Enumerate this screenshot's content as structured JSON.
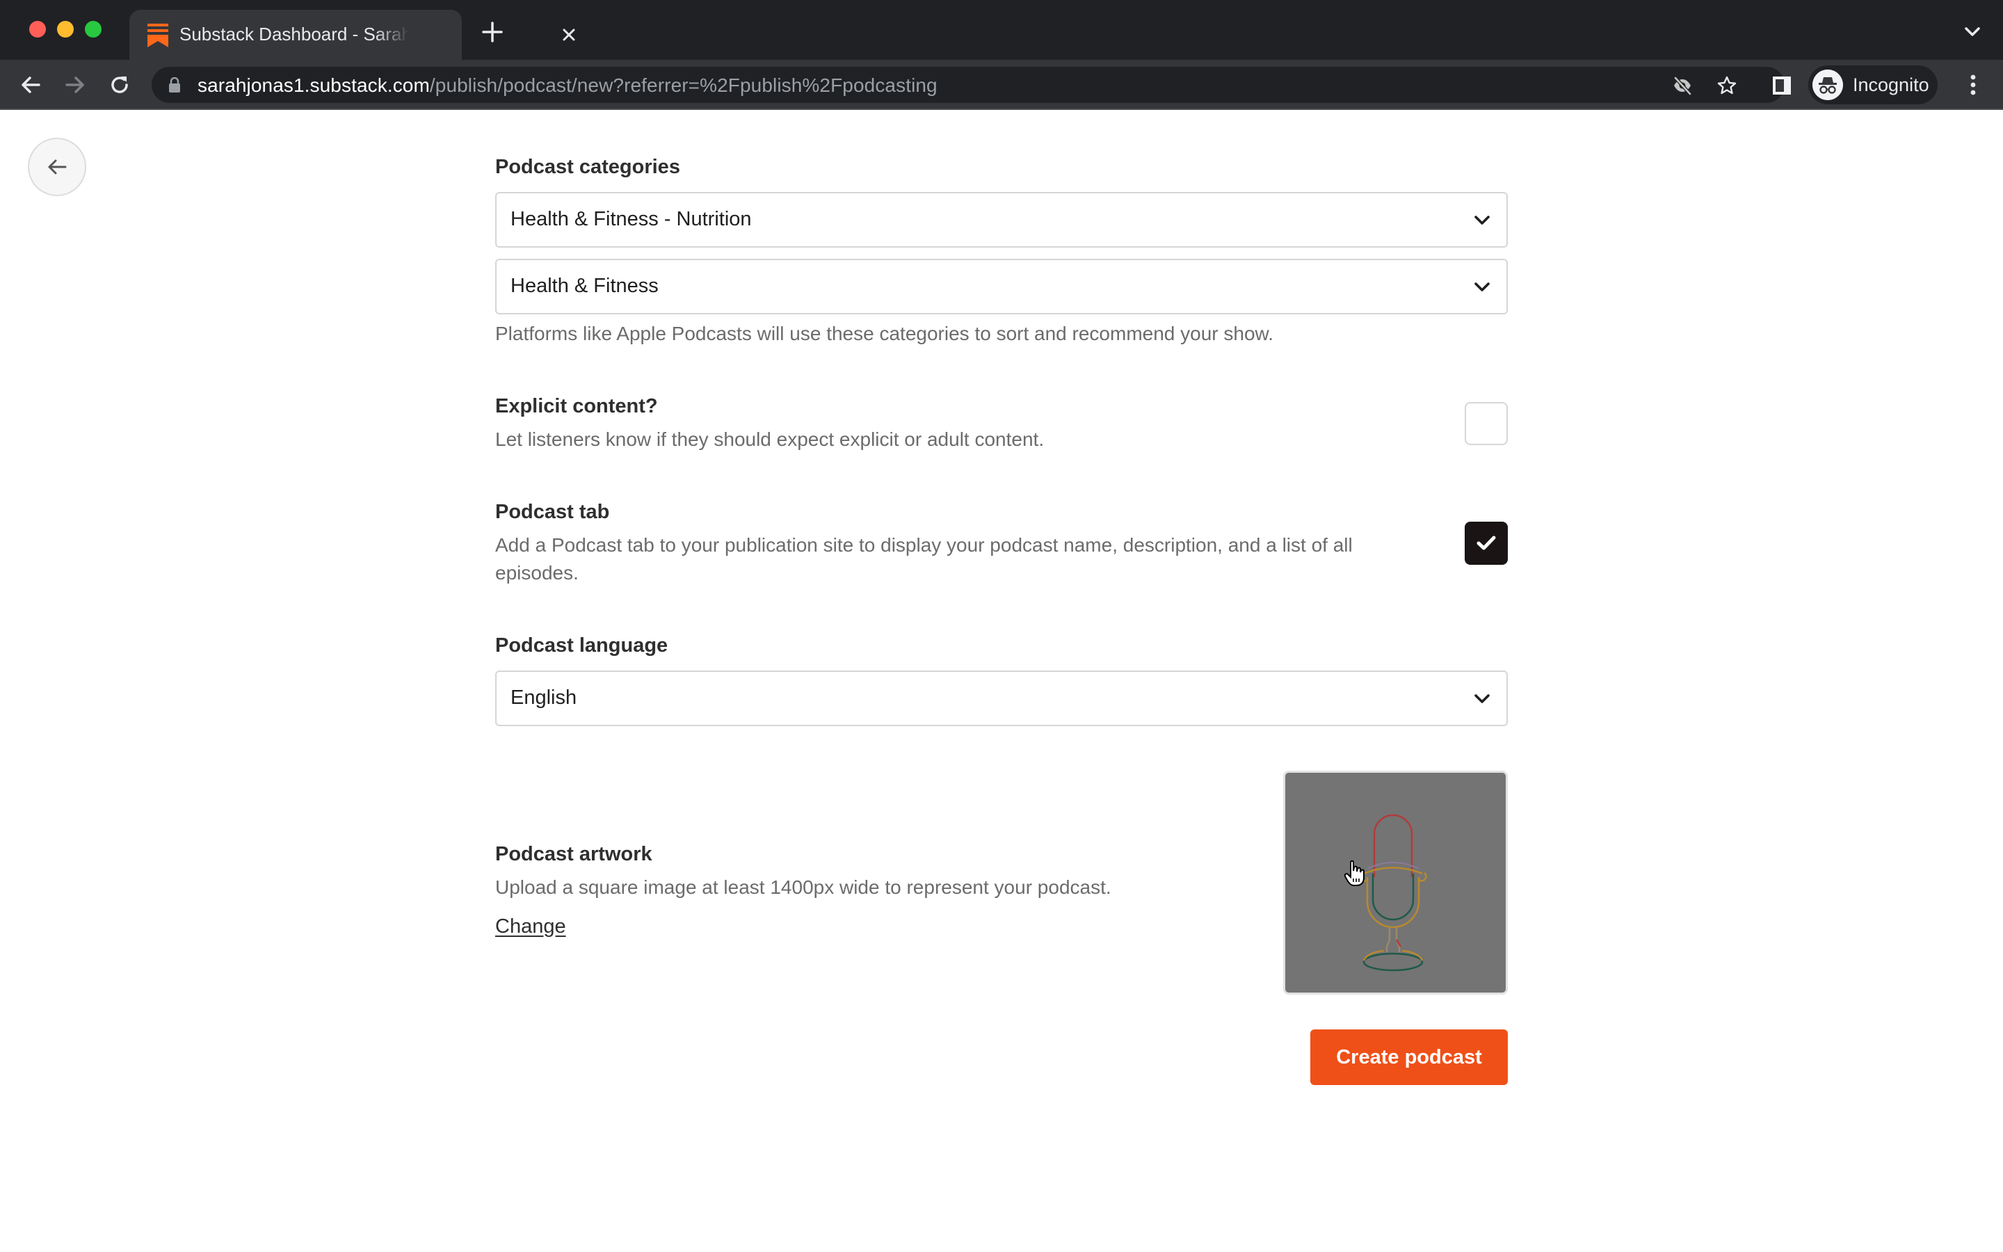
{
  "browser": {
    "tab": {
      "title": "Substack Dashboard - Sarah's",
      "favicon": "substack-logo-icon",
      "close_icon": "close-icon"
    },
    "new_tab_icon": "plus-icon",
    "tab_search_icon": "chevron-down-icon",
    "nav": {
      "back_icon": "arrow-left-icon",
      "forward_icon": "arrow-right-icon",
      "reload_icon": "reload-icon"
    },
    "address_bar": {
      "lock_icon": "lock-icon",
      "host": "sarahjonas1.substack.com",
      "path": "/publish/podcast/new?referrer=%2Fpublish%2Fpodcasting"
    },
    "omnibox_icons": [
      "eye-off-icon",
      "star-icon"
    ],
    "side_panel_icon": "side-panel-icon",
    "profile": {
      "label": "Incognito",
      "icon": "incognito-icon"
    },
    "menu_icon": "kebab-menu-icon"
  },
  "page": {
    "back_button_icon": "arrow-left-icon",
    "categories": {
      "label": "Podcast categories",
      "primary": {
        "value": "Health & Fitness - Nutrition"
      },
      "secondary": {
        "value": "Health & Fitness"
      },
      "help": "Platforms like Apple Podcasts will use these categories to sort and recommend your show."
    },
    "explicit": {
      "label": "Explicit content?",
      "help": "Let listeners know if they should expect explicit or adult content.",
      "checked": false
    },
    "podcast_tab": {
      "label": "Podcast tab",
      "help": "Add a Podcast tab to your publication site to display your podcast name, description, and a list of all episodes.",
      "checked": true
    },
    "language": {
      "label": "Podcast language",
      "value": "English"
    },
    "artwork": {
      "label": "Podcast artwork",
      "help": "Upload a square image at least 1400px wide to represent your podcast.",
      "change_label": "Change",
      "image": "microphone-artwork"
    },
    "create_button": {
      "label": "Create podcast",
      "color": "#ef5018"
    }
  }
}
